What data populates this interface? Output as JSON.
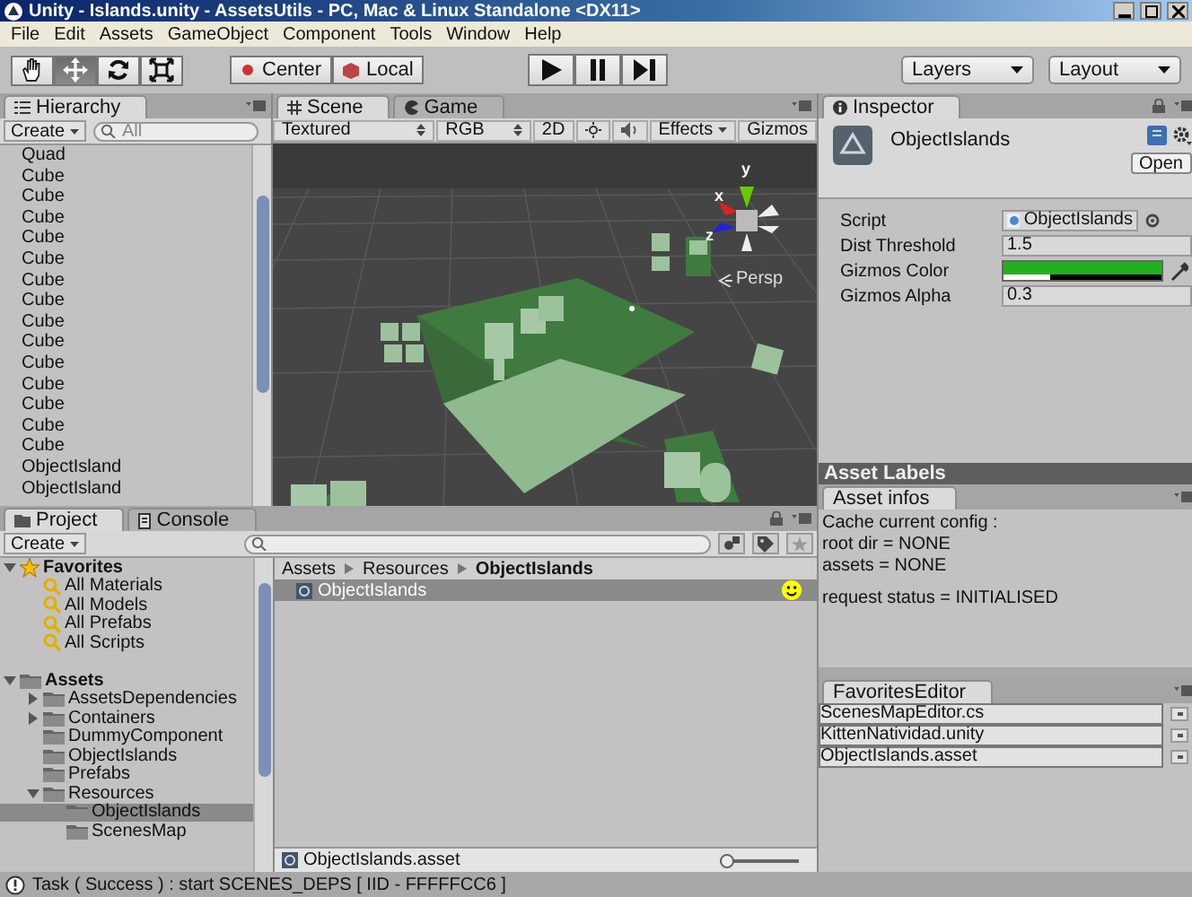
{
  "window": {
    "title": "Unity - Islands.unity - AssetsUtils - PC, Mac & Linux Standalone <DX11>"
  },
  "menu": [
    "File",
    "Edit",
    "Assets",
    "GameObject",
    "Component",
    "Tools",
    "Window",
    "Help"
  ],
  "toolbar": {
    "tools": [
      {
        "kind": "hand",
        "selected": false
      },
      {
        "kind": "move",
        "selected": true
      },
      {
        "kind": "rotate",
        "selected": false
      },
      {
        "kind": "scale",
        "selected": false
      }
    ],
    "pivot": [
      "Center",
      "Local"
    ],
    "playback": [
      {
        "kind": "play"
      },
      {
        "kind": "pause"
      },
      {
        "kind": "step"
      }
    ],
    "layers": "Layers",
    "layout": "Layout"
  },
  "hierarchy": {
    "tab": "Hierarchy",
    "create": "Create",
    "search": {
      "placeholder": "All"
    },
    "items": [
      "Quad",
      "Cube",
      "Cube",
      "Cube",
      "Cube",
      "Cube",
      "Cube",
      "Cube",
      "Cube",
      "Cube",
      "Cube",
      "Cube",
      "Cube",
      "Cube",
      "Cube",
      "ObjectIsland",
      "ObjectIsland"
    ]
  },
  "scene": {
    "tabs": [
      {
        "label": "Scene",
        "selected": true
      },
      {
        "label": "Game",
        "selected": false
      }
    ],
    "lighting_on": false,
    "audio_on": false,
    "shading": "Textured",
    "render_mode": "RGB",
    "mode_2d": "2D",
    "effects": "Effects",
    "gizmos": "Gizmos",
    "gizmo_axes": [
      "y",
      "x",
      "z"
    ],
    "projection": "Persp"
  },
  "inspector": {
    "tab": "Inspector",
    "object_name": "ObjectIslands",
    "open_button": "Open",
    "fields": [
      {
        "label": "Script",
        "kind": "script",
        "value": "ObjectIslands"
      },
      {
        "label": "Dist Threshold",
        "kind": "text",
        "value": "1.5"
      },
      {
        "label": "Gizmos Color",
        "kind": "color",
        "color": "#22b01e",
        "level": 0.3
      },
      {
        "label": "Gizmos Alpha",
        "kind": "text",
        "value": "0.3"
      }
    ],
    "asset_labels": "Asset Labels"
  },
  "asset_infos": {
    "tab": "Asset infos",
    "blocks": [
      [
        "Cache current config :",
        "root dir = NONE",
        "assets = NONE"
      ],
      [
        "request status = INITIALISED"
      ]
    ]
  },
  "project": {
    "tabs": [
      {
        "label": "Project",
        "selected": true
      },
      {
        "label": "Console",
        "selected": false
      }
    ],
    "create": "Create",
    "tree": [
      {
        "label": "Favorites",
        "kind": "favorites",
        "expanded": true,
        "selected": false,
        "children": [
          {
            "label": "All Materials",
            "kind": "search",
            "selected": false
          },
          {
            "label": "All Models",
            "kind": "search",
            "selected": false
          },
          {
            "label": "All Prefabs",
            "kind": "search",
            "selected": false
          },
          {
            "label": "All Scripts",
            "kind": "search",
            "selected": false
          }
        ]
      },
      {
        "label": "Assets",
        "kind": "folder",
        "expanded": true,
        "selected": false,
        "children": [
          {
            "label": "AssetsDependencies",
            "kind": "folder",
            "expanded": false,
            "selected": false
          },
          {
            "label": "Containers",
            "kind": "folder",
            "expanded": false,
            "selected": false
          },
          {
            "label": "DummyComponent",
            "kind": "folder",
            "selected": false
          },
          {
            "label": "ObjectIslands",
            "kind": "folder",
            "selected": false
          },
          {
            "label": "Prefabs",
            "kind": "folder",
            "selected": false
          },
          {
            "label": "Resources",
            "kind": "folder",
            "expanded": true,
            "selected": false,
            "children": [
              {
                "label": "ObjectIslands",
                "kind": "folder",
                "selected": true
              },
              {
                "label": "ScenesMap",
                "kind": "folder",
                "selected": false
              }
            ]
          }
        ]
      }
    ],
    "breadcrumbs": [
      "Assets",
      "Resources",
      "ObjectIslands"
    ],
    "files": [
      {
        "name": "ObjectIslands",
        "selected": true
      }
    ],
    "selected_path": "ObjectIslands.asset",
    "zoom": {
      "level": 0.05
    }
  },
  "favorites_editor": {
    "tab": "FavoritesEditor",
    "entries": [
      "ScenesMapEditor.cs",
      "KittenNatividad.unity",
      "ObjectIslands.asset"
    ]
  },
  "status_bar": {
    "message": "Task ( Success ) : start SCENES_DEPS [ IID - FFFFFCC6 ]"
  }
}
